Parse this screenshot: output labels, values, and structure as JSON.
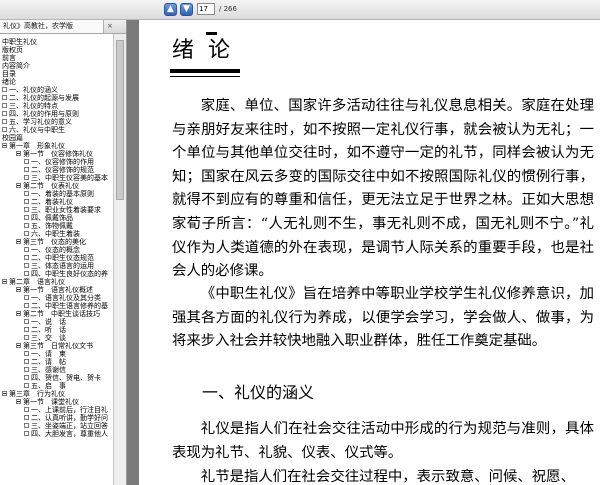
{
  "toolbar": {
    "prev_icon": "arrow-up-icon",
    "next_icon": "arrow-down-icon",
    "prev_glyph": "▲",
    "next_glyph": "▼",
    "page_current": "17",
    "page_total": "/ 266"
  },
  "panel": {
    "tab_label": "礼仪》高教社，农学版",
    "close_glyph": "×"
  },
  "outline": [
    {
      "level": 0,
      "box": "none",
      "text": "中职生礼仪"
    },
    {
      "level": 0,
      "box": "none",
      "text": "版权页"
    },
    {
      "level": 0,
      "box": "none",
      "text": "前言"
    },
    {
      "level": 0,
      "box": "none",
      "text": "内容简介"
    },
    {
      "level": 0,
      "box": "none",
      "text": "目录"
    },
    {
      "level": 0,
      "box": "none",
      "text": "绪论"
    },
    {
      "level": 1,
      "box": "leaf",
      "text": "一、礼仪的涵义"
    },
    {
      "level": 1,
      "box": "leaf",
      "text": "二、礼仪的起源与发展"
    },
    {
      "level": 1,
      "box": "leaf",
      "text": "三、礼仪的特点"
    },
    {
      "level": 1,
      "box": "leaf",
      "text": "四、礼仪的作用与原则"
    },
    {
      "level": 1,
      "box": "leaf",
      "text": "五、学习礼仪的意义"
    },
    {
      "level": 1,
      "box": "leaf",
      "text": "六、礼仪与中职生"
    },
    {
      "level": 0,
      "box": "none",
      "text": "校园篇"
    },
    {
      "level": 1,
      "box": "expanded",
      "text": "第一章　形象礼仪"
    },
    {
      "level": 2,
      "box": "expanded",
      "text": "第一节　仪容修饰礼仪"
    },
    {
      "level": 3,
      "box": "leaf",
      "text": "一、仪容修饰的作用"
    },
    {
      "level": 3,
      "box": "leaf",
      "text": "二、仪容修饰的规范"
    },
    {
      "level": 3,
      "box": "leaf",
      "text": "三、中职生仪容美的基本"
    },
    {
      "level": 2,
      "box": "expanded",
      "text": "第二节　仪表礼仪"
    },
    {
      "level": 3,
      "box": "leaf",
      "text": "一、着装的基本原则"
    },
    {
      "level": 3,
      "box": "leaf",
      "text": "二、着装礼仪"
    },
    {
      "level": 3,
      "box": "leaf",
      "text": "三、职业女性着装要求"
    },
    {
      "level": 3,
      "box": "leaf",
      "text": "四、佩戴饰品"
    },
    {
      "level": 3,
      "box": "leaf",
      "text": "五、饰物佩戴"
    },
    {
      "level": 3,
      "box": "leaf",
      "text": "六、中职生着装"
    },
    {
      "level": 2,
      "box": "expanded",
      "text": "第三节　仪态的美化"
    },
    {
      "level": 3,
      "box": "leaf",
      "text": "一、仪态的概念"
    },
    {
      "level": 3,
      "box": "leaf",
      "text": "二、中职生仪态规范"
    },
    {
      "level": 3,
      "box": "leaf",
      "text": "三、体态语言的运用"
    },
    {
      "level": 3,
      "box": "leaf",
      "text": "四、中职生良好仪态的养"
    },
    {
      "level": 1,
      "box": "expanded",
      "text": "第二章　语言礼仪"
    },
    {
      "level": 2,
      "box": "expanded",
      "text": "第一节　语言礼仪概述"
    },
    {
      "level": 3,
      "box": "leaf",
      "text": "一、语言礼仪及其分类"
    },
    {
      "level": 3,
      "box": "leaf",
      "text": "二、中职生语言修养的基"
    },
    {
      "level": 2,
      "box": "expanded",
      "text": "第二节　中职生谈话技巧"
    },
    {
      "level": 3,
      "box": "leaf",
      "text": "一、说　话"
    },
    {
      "level": 3,
      "box": "leaf",
      "text": "二、听　话"
    },
    {
      "level": 3,
      "box": "leaf",
      "text": "三、交　谈"
    },
    {
      "level": 2,
      "box": "expanded",
      "text": "第三节　日常礼仪文书"
    },
    {
      "level": 3,
      "box": "leaf",
      "text": "一、请　柬"
    },
    {
      "level": 3,
      "box": "leaf",
      "text": "二、请　帖"
    },
    {
      "level": 3,
      "box": "leaf",
      "text": "三、感谢信"
    },
    {
      "level": 3,
      "box": "leaf",
      "text": "四、贺信、贺电、贺卡"
    },
    {
      "level": 3,
      "box": "leaf",
      "text": "五、启　事"
    },
    {
      "level": 1,
      "box": "expanded",
      "text": "第三章　行为礼仪"
    },
    {
      "level": 2,
      "box": "expanded",
      "text": "第一节　课堂礼仪"
    },
    {
      "level": 3,
      "box": "leaf",
      "text": "一、上课前后，行注目礼"
    },
    {
      "level": 3,
      "box": "leaf",
      "text": "二、认真听讲，勤学好问"
    },
    {
      "level": 3,
      "box": "leaf",
      "text": "三、坐姿端正，站立回答"
    },
    {
      "level": 3,
      "box": "leaf",
      "text": "四、大胆发言，尊重他人"
    }
  ],
  "document": {
    "chapter_title": "绪论",
    "paragraphs": [
      "家庭、单位、国家许多活动往往与礼仪息息相关。家庭在处理与亲朋好友来往时，如不按照一定礼仪行事，就会被认为无礼；一个单位与其他单位交往时，如不遵守一定的礼节，同样会被认为无知；国家在风云多变的国际交往中如不按照国际礼仪的惯例行事，就得不到应有的尊重和信任，更无法立足于世界之林。正如大思想家荀子所言：“人无礼则不生，事无礼则不成，国无礼则不宁。”礼仪作为人类道德的外在表现，是调节人际关系的重要手段，也是社会人的必修课。",
      "《中职生礼仪》旨在培养中等职业学校学生礼仪修养意识，加强其各方面的礼仪行为养成，以便学会学习，学会做人、做事，为将来步入社会并较快地融入职业群体，胜任工作奠定基础。",
      "礼仪是指人们在社会交往活动中形成的行为规范与准则，具体表现为礼节、礼貌、仪表、仪式等。",
      "礼节是指人们在社会交往过程中，表示致意、问候、祝愿、"
    ],
    "section_heading": "一、礼仪的涵义"
  }
}
